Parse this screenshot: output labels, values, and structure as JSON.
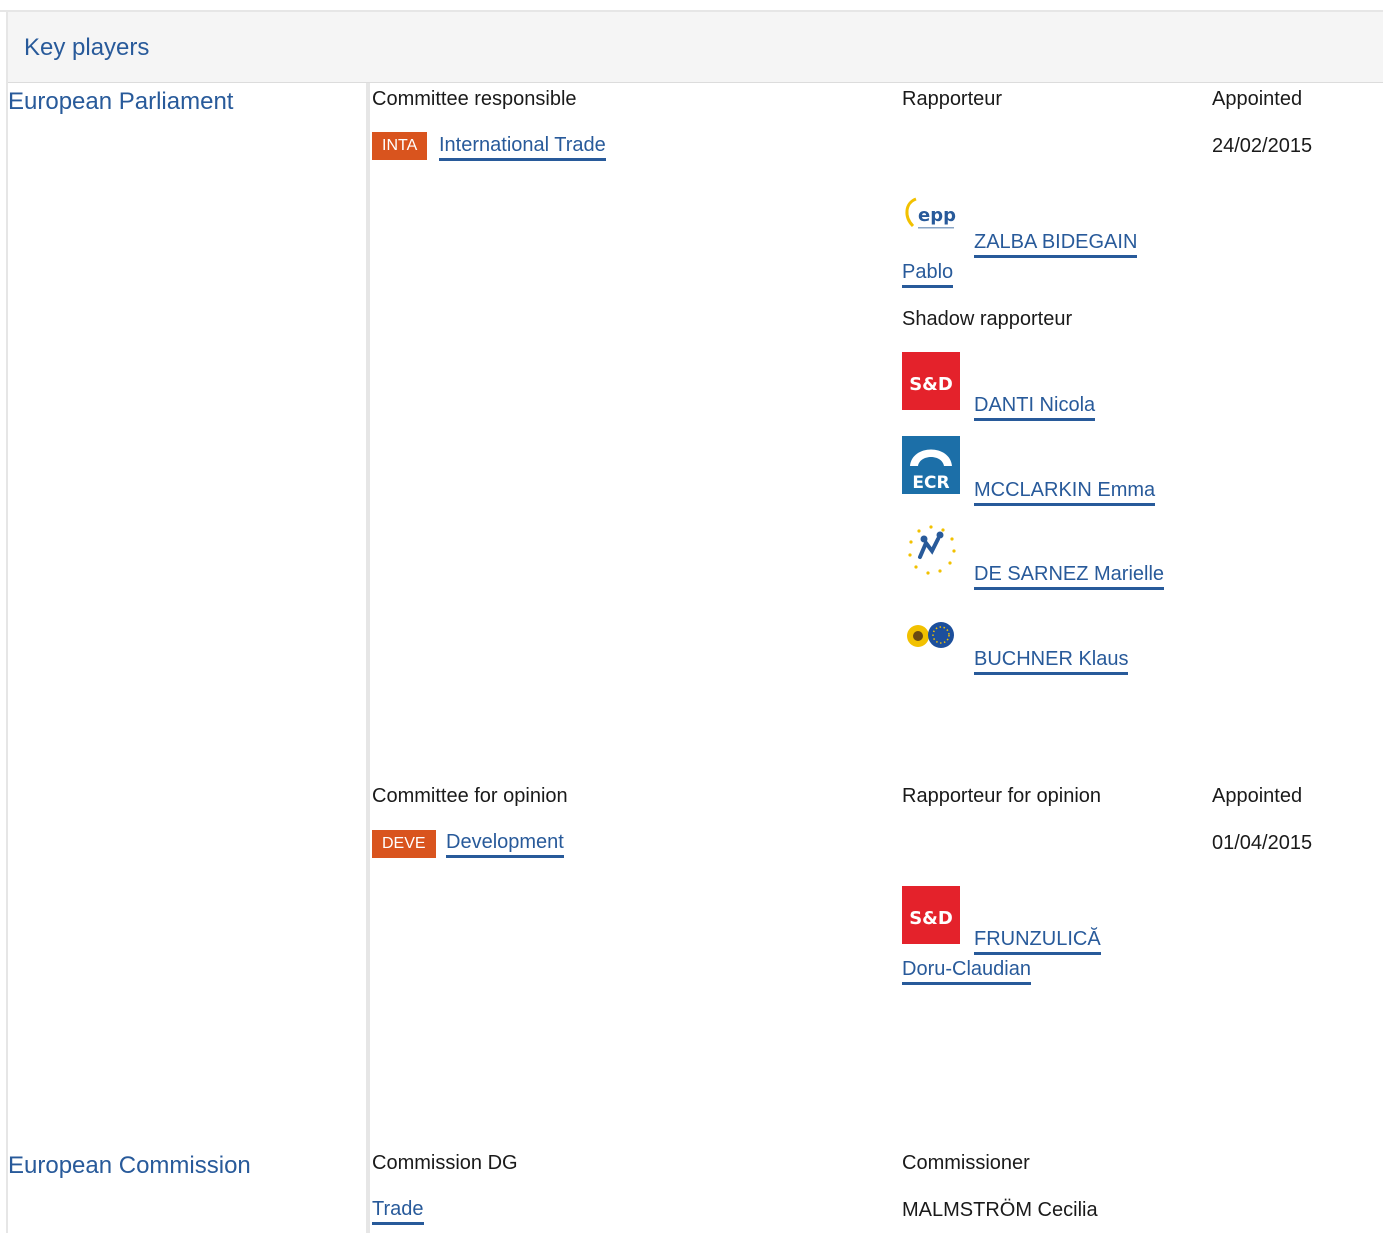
{
  "section": {
    "title": "Key players"
  },
  "parliament": {
    "institution": "European Parliament",
    "responsible": {
      "heading": "Committee responsible",
      "rapporteur_heading": "Rapporteur",
      "appointed_heading": "Appointed",
      "committee": {
        "code": "INTA",
        "name": "International Trade"
      },
      "appointed": "24/02/2015",
      "rapporteur": {
        "group_logo": "epp-logo",
        "name_line1": "ZALBA BIDEGAIN",
        "name_line2": "Pablo"
      },
      "shadow_heading": "Shadow rapporteur",
      "shadows": [
        {
          "group_logo": "sd-logo",
          "logo_text": "S&D",
          "name": "DANTI Nicola"
        },
        {
          "group_logo": "ecr-logo",
          "logo_text": "ECR",
          "name": "MCCLARKIN Emma"
        },
        {
          "group_logo": "alde-logo",
          "name": "DE SARNEZ Marielle"
        },
        {
          "group_logo": "greens-efa-logo",
          "name": "BUCHNER Klaus"
        }
      ]
    },
    "opinion": {
      "heading": "Committee for opinion",
      "rapporteur_heading": "Rapporteur for opinion",
      "appointed_heading": "Appointed",
      "committee": {
        "code": "DEVE",
        "name": "Development"
      },
      "appointed": "01/04/2015",
      "rapporteur": {
        "group_logo": "sd-logo",
        "logo_text": "S&D",
        "name_line1": "FRUNZULICĂ",
        "name_line2": "Doru-Claudian"
      }
    }
  },
  "commission": {
    "institution": "European Commission",
    "dg_heading": "Commission DG",
    "commissioner_heading": "Commissioner",
    "dg": "Trade",
    "commissioner": "MALMSTRÖM Cecilia"
  },
  "colors": {
    "accent": "#285a9a",
    "committee_tag": "#d9541e",
    "sd_red": "#e4222b",
    "ecr_blue": "#1c6fa8"
  }
}
